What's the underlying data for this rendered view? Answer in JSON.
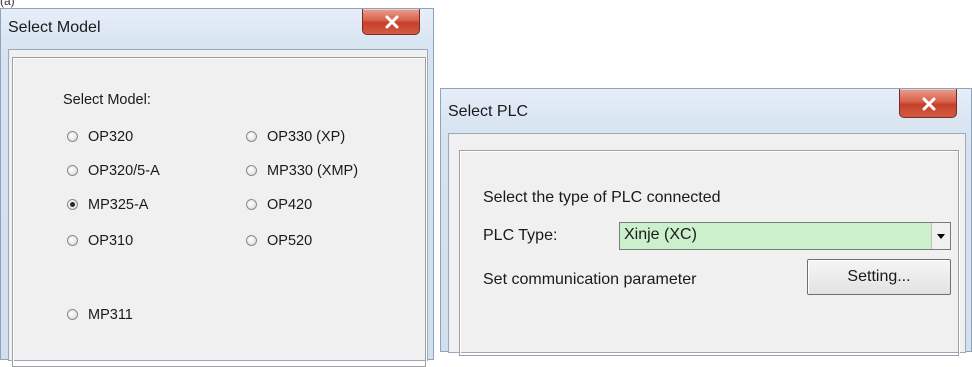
{
  "page_tag": "(a)",
  "select_model_dialog": {
    "title": "Select Model",
    "group_label": "Select Model:",
    "options": [
      {
        "label": "OP320",
        "checked": false
      },
      {
        "label": "OP330 (XP)",
        "checked": false
      },
      {
        "label": "OP320/5-A",
        "checked": false
      },
      {
        "label": "MP330 (XMP)",
        "checked": false
      },
      {
        "label": "MP325-A",
        "checked": true
      },
      {
        "label": "OP420",
        "checked": false
      },
      {
        "label": "OP310",
        "checked": false
      },
      {
        "label": "OP520",
        "checked": false
      },
      {
        "label": "MP311",
        "checked": false
      }
    ]
  },
  "select_plc_dialog": {
    "title": "Select PLC",
    "prompt": "Select the type of PLC connected",
    "plc_type_label": "PLC Type:",
    "plc_type_value": "Xinje (XC)",
    "comm_label": "Set communication parameter",
    "setting_button": "Setting..."
  },
  "colors": {
    "close_button": "#d4513a",
    "select_highlight": "#ccefcc"
  }
}
